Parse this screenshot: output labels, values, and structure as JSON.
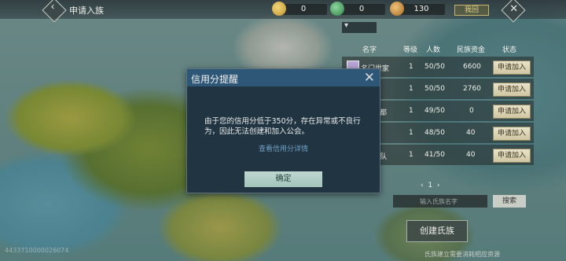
{
  "header": {
    "title": "申请入族",
    "resources": [
      {
        "name": "gold-coins-icon",
        "value": "0",
        "color": "#d9b24a"
      },
      {
        "name": "jade-icon",
        "value": "0",
        "color": "#3f9d5a"
      },
      {
        "name": "ingot-icon",
        "value": "130",
        "color": "#c9913a"
      }
    ],
    "home_label": "我回"
  },
  "clan_table": {
    "dropdown_value": "▾",
    "columns": [
      "名字",
      "等级",
      "人数",
      "民族资金",
      "状态"
    ],
    "rows": [
      {
        "name": "名门世家",
        "level": "1",
        "members": "50/50",
        "funds": "6600",
        "action": "申请加入"
      },
      {
        "name": "",
        "level": "1",
        "members": "50/50",
        "funds": "2760",
        "action": "申请加入"
      },
      {
        "name": "都",
        "level": "1",
        "members": "49/50",
        "funds": "0",
        "action": "申请加入"
      },
      {
        "name": "",
        "level": "1",
        "members": "48/50",
        "funds": "40",
        "action": "申请加入"
      },
      {
        "name": "队",
        "level": "1",
        "members": "41/50",
        "funds": "40",
        "action": "申请加入"
      }
    ],
    "pager": {
      "prev": "‹",
      "page": "1",
      "next": "›"
    },
    "search_placeholder": "输入氏族名字",
    "search_label": "搜索",
    "create_label": "创建氏族",
    "hint": "氏族建立需要消耗相应资源",
    "uid": "4433710000026074"
  },
  "modal": {
    "title": "信用分提醒",
    "body": "由于您的信用分低于350分，存在异常或不良行为，因此无法创建和加入公会。",
    "link": "查看信用分详情",
    "ok_label": "确定"
  }
}
